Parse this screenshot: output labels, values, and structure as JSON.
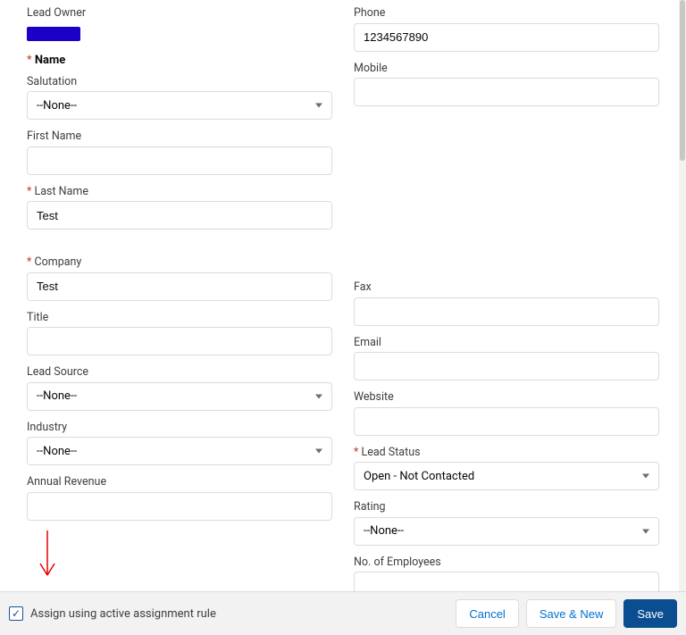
{
  "left": {
    "leadOwner": {
      "label": "Lead Owner"
    },
    "nameHeading": "Name",
    "salutation": {
      "label": "Salutation",
      "value": "--None--"
    },
    "firstName": {
      "label": "First Name",
      "value": ""
    },
    "lastName": {
      "label": "Last Name",
      "value": "Test"
    },
    "company": {
      "label": "Company",
      "value": "Test"
    },
    "title": {
      "label": "Title",
      "value": ""
    },
    "leadSource": {
      "label": "Lead Source",
      "value": "--None--"
    },
    "industry": {
      "label": "Industry",
      "value": "--None--"
    },
    "annualRevenue": {
      "label": "Annual Revenue",
      "value": ""
    }
  },
  "right": {
    "phone": {
      "label": "Phone",
      "value": "1234567890"
    },
    "mobile": {
      "label": "Mobile",
      "value": ""
    },
    "fax": {
      "label": "Fax",
      "value": ""
    },
    "email": {
      "label": "Email",
      "value": ""
    },
    "website": {
      "label": "Website",
      "value": ""
    },
    "leadStatus": {
      "label": "Lead Status",
      "value": "Open - Not Contacted"
    },
    "rating": {
      "label": "Rating",
      "value": "--None--"
    },
    "noEmployees": {
      "label": "No. of Employees",
      "value": ""
    }
  },
  "footer": {
    "assignLabel": "Assign using active assignment rule",
    "cancel": "Cancel",
    "saveNew": "Save & New",
    "save": "Save"
  }
}
